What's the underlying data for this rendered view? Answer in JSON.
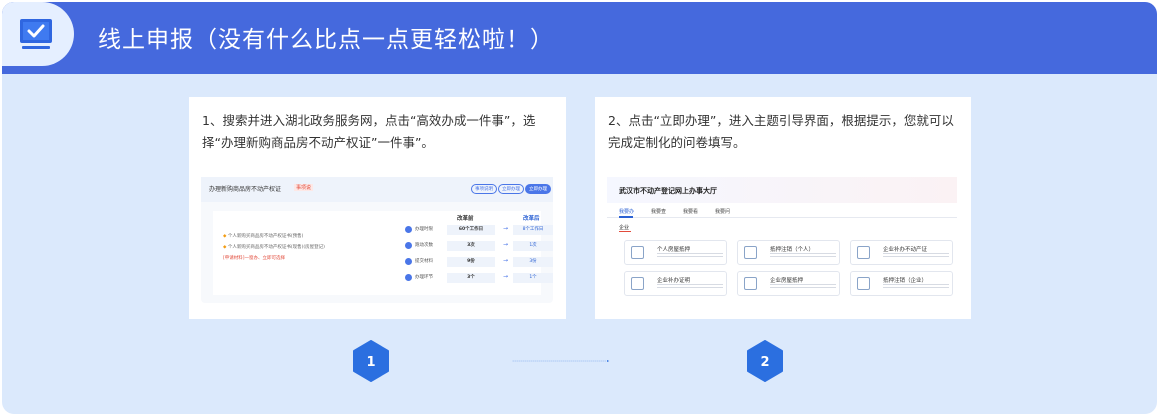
{
  "header": {
    "title": "线上申报（没有什么比点一点更轻松啦！）",
    "icon": "monitor-check-icon",
    "bg_color": "#4569dd"
  },
  "cards": [
    {
      "step": "1",
      "text": "1、搜索并进入湖北政务服务网，点击“高效办成一件事”，选择“办理新购商品房不动产权证”一件事”。",
      "screenshot": {
        "title": "办理新购商品房不动产权证",
        "tag": "事项说",
        "buttons": [
          "事项说明",
          "立即办理",
          "立即办理"
        ],
        "notes": [
          "个人新购买商品房不动产权证书(预售)",
          "个人新购买商品房不动产权证书(现售)(房屋登记)",
          "[申请材料]一窗办、立即可选择"
        ],
        "col_before": "改革前",
        "col_after": "改革后",
        "rows": [
          {
            "label": "办理时限",
            "before": "60个工作日",
            "after": "8个工作日"
          },
          {
            "label": "跑动次数",
            "before": "3次",
            "after": "1次"
          },
          {
            "label": "提交材料",
            "before": "9份",
            "after": "3份"
          },
          {
            "label": "办理环节",
            "before": "3个",
            "after": "1个"
          }
        ]
      }
    },
    {
      "step": "2",
      "text": "2、点击“立即办理”，进入主题引导界面，根据提示，您就可以完成定制化的问卷填写。",
      "screenshot": {
        "title": "武汉市不动产登记网上办事大厅",
        "tabs": [
          "我要办",
          "我要查",
          "我要看",
          "我要问"
        ],
        "section": "企业",
        "tiles": [
          "个人房屋抵押",
          "抵押注销（个人）",
          "企业补办不动产证",
          "企业补办证明",
          "企业房屋抵押",
          "抵押注销（企业）"
        ]
      }
    }
  ],
  "steps": [
    "1",
    "2"
  ],
  "colors": {
    "accent": "#2b6fe0",
    "frame_bg": "#dbe9fc"
  }
}
